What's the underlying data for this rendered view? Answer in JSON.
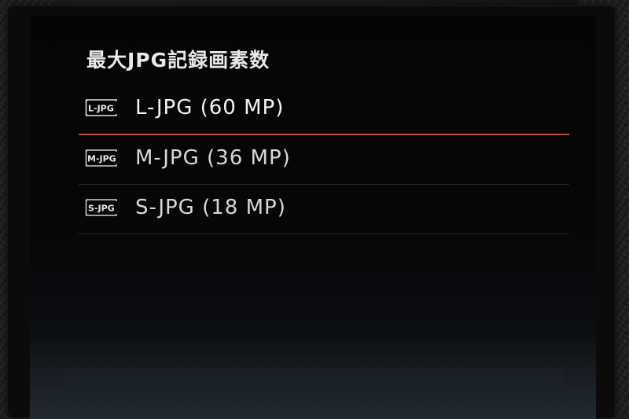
{
  "menu": {
    "title": "最大JPG記録画素数",
    "items": [
      {
        "icon_text": "L-JPG",
        "icon_name": "l-jpg-icon",
        "label": "L-JPG (60 MP)",
        "selected": true
      },
      {
        "icon_text": "M-JPG",
        "icon_name": "m-jpg-icon",
        "label": "M-JPG (36 MP)",
        "selected": false
      },
      {
        "icon_text": "S-JPG",
        "icon_name": "s-jpg-icon",
        "label": "S-JPG (18 MP)",
        "selected": false
      }
    ]
  },
  "colors": {
    "selection_accent": "#e03a1e",
    "text": "#e9e9e9",
    "divider": "#2a2a2a",
    "screen_background": "#050506"
  }
}
